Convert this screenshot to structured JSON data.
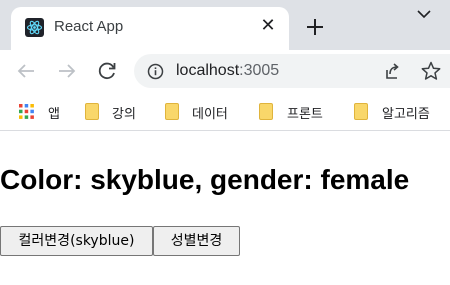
{
  "browser": {
    "tab": {
      "title": "React App",
      "favicon": "react-logo-icon",
      "close_glyph": "✕"
    },
    "new_tab_glyph": "+",
    "address_bar": {
      "host": "localhost",
      "port": ":3005"
    },
    "bookmarks": [
      {
        "label": "앱",
        "icon": "apps-grid-icon"
      },
      {
        "label": "강의",
        "icon": "folder-icon"
      },
      {
        "label": "데이터",
        "icon": "folder-icon"
      },
      {
        "label": "프론트",
        "icon": "folder-icon"
      },
      {
        "label": "알고리즘",
        "icon": "folder-icon"
      }
    ]
  },
  "page": {
    "heading": "Color: skyblue, gender: female",
    "buttons": {
      "color_change": "컬러변경(skyblue)",
      "gender_change": "성별변경"
    }
  },
  "colors": {
    "tabstrip": "#dee1e6",
    "omnibox": "#f1f3f4",
    "folder": "#f9d76a",
    "react": "#61dafb"
  }
}
